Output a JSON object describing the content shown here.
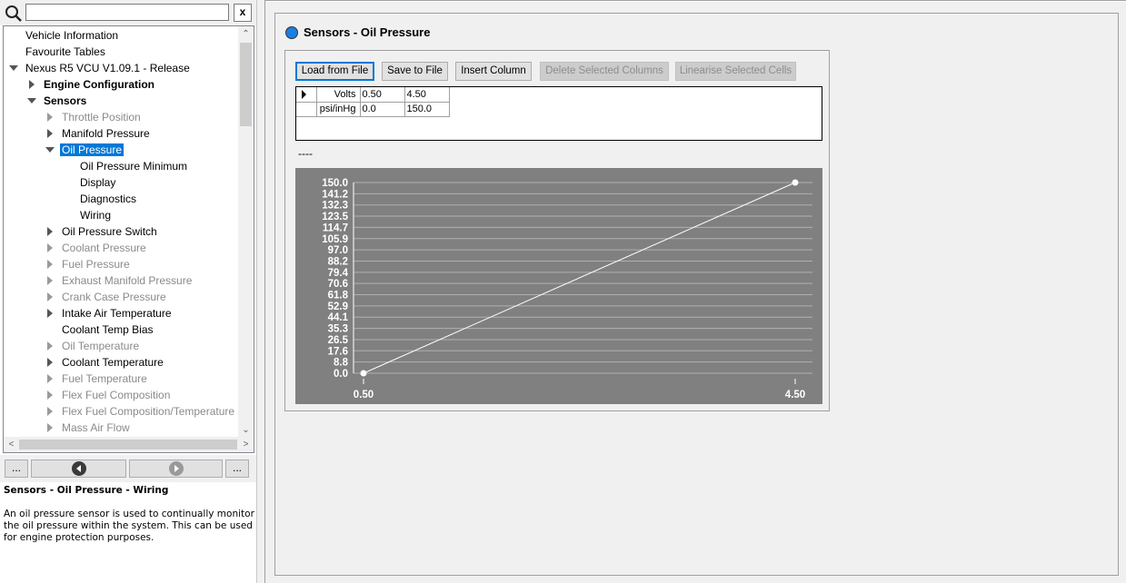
{
  "search": {
    "value": "",
    "clear_label": "x"
  },
  "tree": [
    {
      "label": "Vehicle Information",
      "level": 1,
      "expander": "none",
      "style": "normal"
    },
    {
      "label": "Favourite Tables",
      "level": 1,
      "expander": "none",
      "style": "normal"
    },
    {
      "label": "Nexus R5 VCU V1.09.1 - Release",
      "level": 1,
      "expander": "down",
      "style": "normal"
    },
    {
      "label": "Engine Configuration",
      "level": 2,
      "expander": "right",
      "style": "bold"
    },
    {
      "label": "Sensors",
      "level": 2,
      "expander": "down",
      "style": "bold"
    },
    {
      "label": "Throttle Position",
      "level": 3,
      "expander": "right",
      "style": "grey"
    },
    {
      "label": "Manifold Pressure",
      "level": 3,
      "expander": "right",
      "style": "normal"
    },
    {
      "label": "Oil Pressure",
      "level": 3,
      "expander": "down",
      "style": "selected"
    },
    {
      "label": "Oil Pressure Minimum",
      "level": 4,
      "expander": "none",
      "style": "normal"
    },
    {
      "label": "Display",
      "level": 4,
      "expander": "none",
      "style": "normal"
    },
    {
      "label": "Diagnostics",
      "level": 4,
      "expander": "none",
      "style": "normal"
    },
    {
      "label": "Wiring",
      "level": 4,
      "expander": "none",
      "style": "normal"
    },
    {
      "label": "Oil Pressure Switch",
      "level": 3,
      "expander": "right",
      "style": "normal"
    },
    {
      "label": "Coolant Pressure",
      "level": 3,
      "expander": "right",
      "style": "grey"
    },
    {
      "label": "Fuel Pressure",
      "level": 3,
      "expander": "right",
      "style": "grey"
    },
    {
      "label": "Exhaust Manifold Pressure",
      "level": 3,
      "expander": "right",
      "style": "grey"
    },
    {
      "label": "Crank Case Pressure",
      "level": 3,
      "expander": "right",
      "style": "grey"
    },
    {
      "label": "Intake Air Temperature",
      "level": 3,
      "expander": "right",
      "style": "normal"
    },
    {
      "label": "Coolant Temp Bias",
      "level": 3,
      "expander": "none",
      "style": "normal"
    },
    {
      "label": "Oil Temperature",
      "level": 3,
      "expander": "right",
      "style": "grey"
    },
    {
      "label": "Coolant Temperature",
      "level": 3,
      "expander": "right",
      "style": "normal"
    },
    {
      "label": "Fuel Temperature",
      "level": 3,
      "expander": "right",
      "style": "grey"
    },
    {
      "label": "Flex Fuel Composition",
      "level": 3,
      "expander": "right",
      "style": "grey"
    },
    {
      "label": "Flex Fuel Composition/Temperature S",
      "level": 3,
      "expander": "right",
      "style": "grey"
    },
    {
      "label": "Mass Air Flow",
      "level": 3,
      "expander": "right",
      "style": "grey"
    }
  ],
  "nav": {
    "more_left": "...",
    "more_right": "..."
  },
  "help": {
    "title": "Sensors - Oil Pressure - Wiring",
    "body": "An oil pressure sensor is used to continually monitor the oil pressure within the system. This can be used for engine protection purposes."
  },
  "page": {
    "title": "Sensors - Oil Pressure"
  },
  "toolbar": {
    "load": "Load from File",
    "save": "Save to File",
    "insert": "Insert Column",
    "delete": "Delete Selected Columns",
    "linearise": "Linearise Selected Cells"
  },
  "table": {
    "rows": [
      {
        "name": "Volts",
        "values": [
          "0.50",
          "4.50"
        ]
      },
      {
        "name": "psi/inHg",
        "values": [
          "0.0",
          "150.0"
        ]
      }
    ]
  },
  "status_text": "----",
  "colors": {
    "accent": "#0078d7",
    "chart_bg": "#808080",
    "grid": "#b0b0b0"
  },
  "chart_data": {
    "type": "line",
    "title": "",
    "xlabel": "",
    "ylabel": "",
    "x": [
      0.5,
      4.5
    ],
    "x_tick_labels": [
      "0.50",
      "4.50"
    ],
    "y_tick_labels": [
      "150.0",
      "141.2",
      "132.3",
      "123.5",
      "114.7",
      "105.9",
      "97.0",
      "88.2",
      "79.4",
      "70.6",
      "61.8",
      "52.9",
      "44.1",
      "35.3",
      "26.5",
      "17.6",
      "8.8",
      "0.0"
    ],
    "ylim": [
      0,
      150
    ],
    "grid": true,
    "series": [
      {
        "values": [
          0.0,
          150.0
        ]
      }
    ]
  }
}
